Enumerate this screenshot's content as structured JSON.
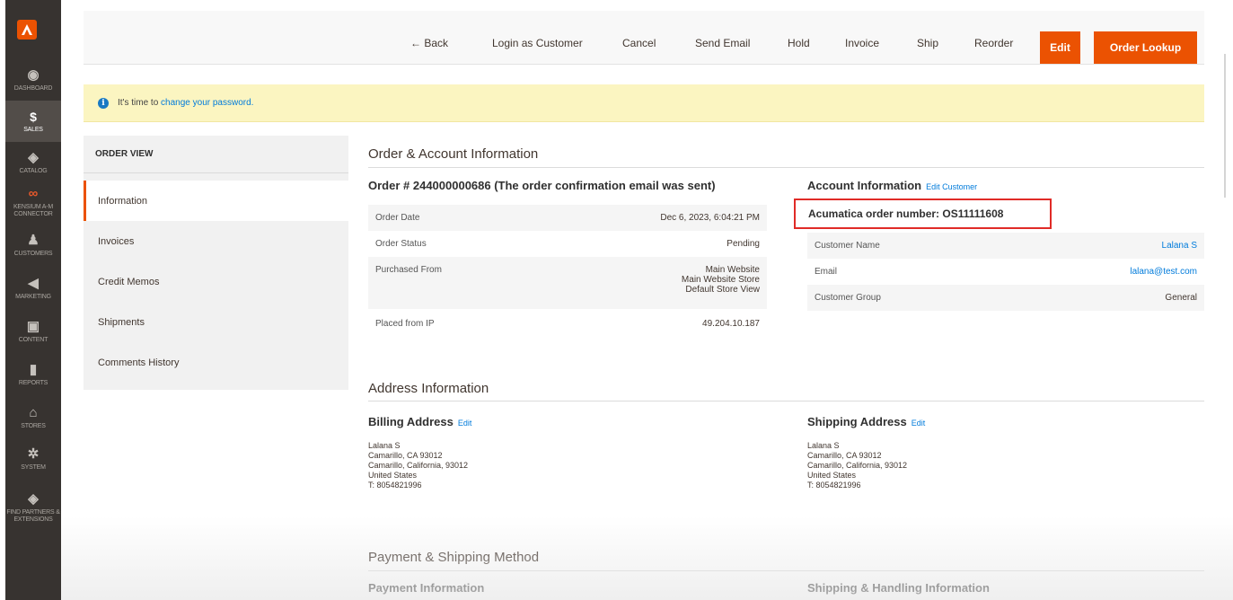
{
  "sidebar": {
    "logo": "magento-logo",
    "items": [
      {
        "label": "DASHBOARD",
        "icon": "dashboard-icon"
      },
      {
        "label": "SALES",
        "icon": "dollar-icon"
      },
      {
        "label": "CATALOG",
        "icon": "catalog-icon"
      },
      {
        "label": "KENSIUM A-M CONNECTOR",
        "icon": "connector-icon"
      },
      {
        "label": "CUSTOMERS",
        "icon": "customers-icon"
      },
      {
        "label": "MARKETING",
        "icon": "megaphone-icon"
      },
      {
        "label": "CONTENT",
        "icon": "content-icon"
      },
      {
        "label": "REPORTS",
        "icon": "bar-chart-icon"
      },
      {
        "label": "STORES",
        "icon": "store-icon"
      },
      {
        "label": "SYSTEM",
        "icon": "gear-icon"
      },
      {
        "label": "FIND PARTNERS & EXTENSIONS",
        "icon": "extensions-icon"
      }
    ],
    "active": "SALES"
  },
  "header": {
    "back": "← Back",
    "login_as_customer": "Login as Customer",
    "cancel": "Cancel",
    "send_email": "Send Email",
    "hold": "Hold",
    "invoice": "Invoice",
    "ship": "Ship",
    "reorder": "Reorder",
    "edit": "Edit",
    "order_lookup": "Order Lookup"
  },
  "notice": {
    "prefix": "It's time to",
    "link": "change your password."
  },
  "order_view": {
    "title": "ORDER VIEW",
    "tabs": [
      "Information",
      "Invoices",
      "Credit Memos",
      "Shipments",
      "Comments History"
    ],
    "active_tab": "Information"
  },
  "order_account": {
    "section_title": "Order & Account Information",
    "order_heading": "Order # 244000000686 (The order confirmation email was sent)",
    "order_rows": [
      {
        "label": "Order Date",
        "value": "Dec 6, 2023, 6:04:21 PM"
      },
      {
        "label": "Order Status",
        "value": "Pending"
      },
      {
        "label": "Purchased From",
        "value_lines": [
          "Main Website",
          "Main Website Store",
          "Default Store View"
        ]
      },
      {
        "label": "Placed from IP",
        "value": "49.204.10.187"
      }
    ],
    "account_heading": "Account Information",
    "edit_customer": "Edit Customer",
    "acumatica_order": "Acumatica order number: OS11111608",
    "account_rows": [
      {
        "label": "Customer Name",
        "value": "Lalana S",
        "link": true
      },
      {
        "label": "Email",
        "value": "lalana@test.com",
        "link": true
      },
      {
        "label": "Customer Group",
        "value": "General",
        "link": false
      }
    ]
  },
  "address": {
    "section_title": "Address Information",
    "billing_heading": "Billing Address",
    "shipping_heading": "Shipping Address",
    "edit_label": "Edit",
    "billing_lines": [
      "Lalana S",
      "Camarillo, CA 93012",
      "Camarillo, California, 93012",
      "United States",
      "T: 8054821996"
    ],
    "shipping_lines": [
      "Lalana S",
      "Camarillo, CA 93012",
      "Camarillo, California, 93012",
      "United States",
      "T: 8054821996"
    ]
  },
  "payment": {
    "section_title": "Payment & Shipping Method",
    "payment_heading": "Payment Information",
    "shipping_heading": "Shipping & Handling Information"
  },
  "colors": {
    "accent": "#eb5202",
    "link": "#007bdb",
    "highlight_border": "#e02b27",
    "sidebar_bg": "#373330",
    "notice_bg": "#fbf5c1"
  }
}
